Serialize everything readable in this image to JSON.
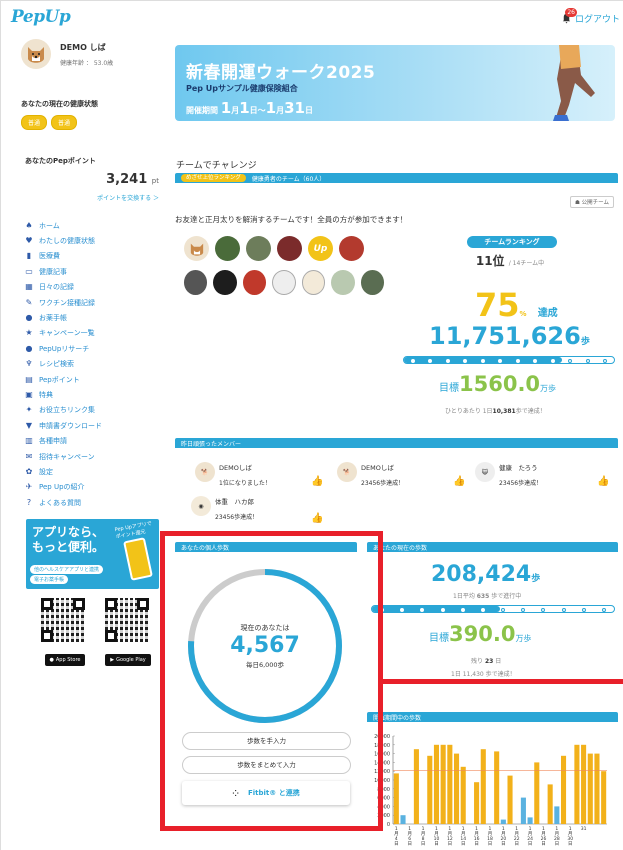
{
  "header": {
    "logo": "PepUp",
    "logout": "ログアウト",
    "notif_count": "26"
  },
  "profile": {
    "name": "DEMO しば",
    "age": "健康年齢 ： 53.0歳"
  },
  "health_status": {
    "title": "あなたの現在の健康状態",
    "badges": [
      "普通",
      "普通"
    ]
  },
  "points": {
    "title": "あなたのPepポイント",
    "value": "3,241",
    "unit": "pt",
    "exchange": "ポイントを交換する ＞"
  },
  "nav": [
    {
      "icon": "home-icon",
      "glyph": "♠",
      "label": "ホーム"
    },
    {
      "icon": "heart-icon",
      "glyph": "♥",
      "label": "わたしの健康状態"
    },
    {
      "icon": "chart-icon",
      "glyph": "▮",
      "label": "医療費"
    },
    {
      "icon": "card-icon",
      "glyph": "▭",
      "label": "健康記事"
    },
    {
      "icon": "calendar-icon",
      "glyph": "▦",
      "label": "日々の記録"
    },
    {
      "icon": "syringe-icon",
      "glyph": "✎",
      "label": "ワクチン接種記録"
    },
    {
      "icon": "medicine-icon",
      "glyph": "●",
      "label": "お薬手帳"
    },
    {
      "icon": "star-icon",
      "glyph": "★",
      "label": "キャンペーン一覧"
    },
    {
      "icon": "research-icon",
      "glyph": "●",
      "label": "PepUpリサーチ"
    },
    {
      "icon": "recipe-icon",
      "glyph": "♆",
      "label": "レシピ検索"
    },
    {
      "icon": "point-icon",
      "glyph": "▤",
      "label": "Pepポイント"
    },
    {
      "icon": "gift-icon",
      "glyph": "▣",
      "label": "特典"
    },
    {
      "icon": "link-icon",
      "glyph": "✦",
      "label": "お役立ちリンク集"
    },
    {
      "icon": "download-icon",
      "glyph": "▼",
      "label": "申請書ダウンロード"
    },
    {
      "icon": "form-icon",
      "glyph": "▥",
      "label": "各種申請"
    },
    {
      "icon": "invite-icon",
      "glyph": "✉",
      "label": "招待キャンペーン"
    },
    {
      "icon": "gear-icon",
      "glyph": "✿",
      "label": "設定"
    },
    {
      "icon": "info-icon",
      "glyph": "✈",
      "label": "Pep Upの紹介"
    },
    {
      "icon": "faq-icon",
      "glyph": "?",
      "label": "よくある質問"
    }
  ],
  "app_banner": {
    "title": "アプリなら、\nもっと便利。",
    "note": "Pep Upアプリで\nポイント還元",
    "tag1": "他のヘルスケアアプリと連携",
    "tag2": "電子お薬手帳",
    "app_store": "App Store",
    "google_play": "Google Play"
  },
  "campaign": {
    "title": "新春開運ウォーク2025",
    "org": "Pep Upサンプル健康保険組合",
    "period_label": "開催期間",
    "m1": "1",
    "d1": "1",
    "m2": "1",
    "d2": "31",
    "jm": "月",
    "jd": "日",
    "sep": "～"
  },
  "team": {
    "section": "チームでチャレンジ",
    "tag": "めざせ上位ランキング",
    "team_name": "健康勇者のチーム（60人）",
    "public_button": "公開チーム",
    "description": "お友達と正月太りを解消するチームです！全員の方が参加できます！",
    "ranking_label": "チームランキング",
    "rank": "11",
    "rank_unit": "位",
    "rank_total": "/ 14チーム中",
    "achieve_value": "75",
    "achieve_pct": "%",
    "achieve_label": "達成",
    "steps": "11,751,626",
    "steps_unit": "歩",
    "goal_label": "目標",
    "goal_value": "1560.0",
    "goal_unit": "万歩",
    "per_person_prefix": "ひとりあたり 1日",
    "per_person_value": "10,381",
    "per_person_suffix": "歩で達成！",
    "progress": 0.75
  },
  "members": {
    "title": "昨日頑張ったメンバー",
    "list": [
      {
        "name": "DEMOしば",
        "msg": "1位になりました！"
      },
      {
        "name": "DEMOしば",
        "msg": "23456歩達成！"
      },
      {
        "name": "健康　たろう",
        "msg": "23456歩達成！"
      },
      {
        "name": "体重　ハカ郎",
        "msg": "23456歩達成！"
      }
    ]
  },
  "personal": {
    "title": "あなたの個人歩数",
    "now_label": "現在のあなたは",
    "value": "4,567",
    "daily": "毎日6,000歩",
    "manual_button": "歩数を手入力",
    "bulk_button": "歩数をまとめて入力",
    "fitbit_button": "Fitbit® と連携",
    "ring_progress": 0.76
  },
  "current": {
    "title": "あなたの現在の歩数",
    "value": "208,424",
    "unit": "歩",
    "avg_prefix": "1日平均",
    "avg_value": "635",
    "avg_suffix": "歩で進行中",
    "goal_label": "目標",
    "goal_value": "390.0",
    "goal_unit": "万歩",
    "remain_prefix": "残り",
    "remain_value": "23",
    "remain_suffix": "日",
    "remain2": "1日 11,430 歩で達成！",
    "progress": 0.53
  },
  "chart_data": {
    "type": "bar",
    "title": "開催期間中の歩数",
    "y_ticks": [
      "20000",
      "18000",
      "16000",
      "14000",
      "12000",
      "10000",
      "8000",
      "6000",
      "4000",
      "2000",
      "0"
    ],
    "ylim": [
      0,
      20000
    ],
    "categories": [
      "1月4日",
      "1月6日",
      "1月8日",
      "1月10日",
      "1月12日",
      "1月14日",
      "1月16日",
      "1月18日",
      "1月20日",
      "1月22日",
      "1月24日",
      "1月26日",
      "1月28日",
      "1月30日"
    ],
    "x_labels": [
      "1\n月\n4\n日",
      "1\n月\n6\n日",
      "1\n月\n8\n日",
      "1\n月\n10\n日",
      "1\n月\n12\n日",
      "1\n月\n14\n日",
      "1\n月\n16\n日",
      "1\n月\n18\n日",
      "1\n月\n20\n日",
      "1\n月\n22\n日",
      "1\n月\n24\n日",
      "1\n月\n26\n日",
      "1\n月\n28\n日",
      "1\n月\n30\n日",
      "31"
    ],
    "values": [
      11500,
      2000,
      0,
      17000,
      0,
      15500,
      18000,
      18000,
      18000,
      16000,
      13000,
      0,
      9500,
      17000,
      0,
      16500,
      1000,
      11000,
      0,
      6000,
      1500,
      14000,
      0,
      9000,
      4000,
      15500,
      0,
      18000,
      18000,
      16000,
      16000,
      12000
    ],
    "goal_line": 12200,
    "colors": {
      "bar": "#f2b11a",
      "low": "#5ab2e0",
      "goal": "#f08a5d"
    }
  },
  "colors": {
    "accent": "#2aa6d6",
    "yellow": "#f2c318",
    "green": "#8bc34a",
    "red": "#e8202a"
  }
}
